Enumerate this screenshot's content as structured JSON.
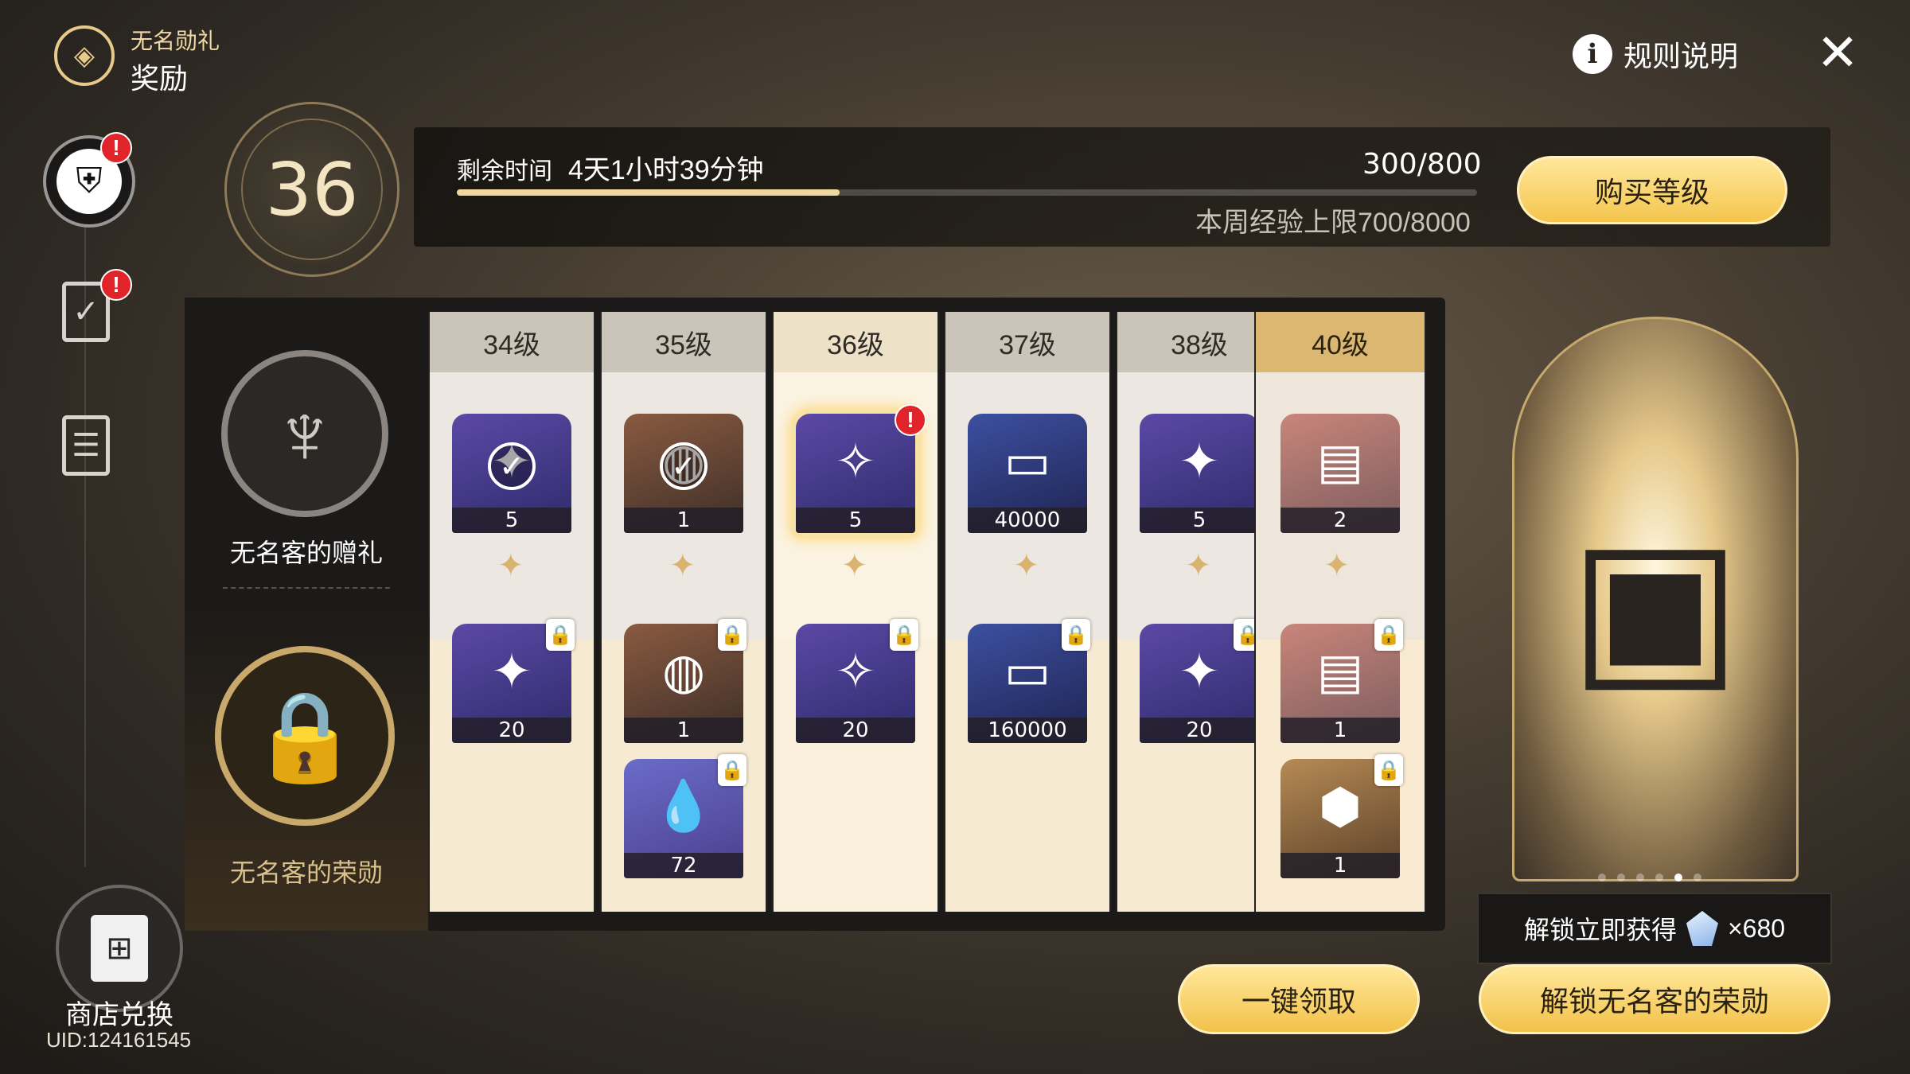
{
  "header": {
    "subtitle": "无名勋礼",
    "title": "奖励",
    "rules_label": "规则说明",
    "rules_icon": "info-icon",
    "close_icon": "close-icon"
  },
  "nav": {
    "badge": "!",
    "shop_label": "商店兑换",
    "uid": "UID:124161545"
  },
  "level": {
    "current": "36",
    "time_label": "剩余时间",
    "time_value": "4天1小时39分钟",
    "xp": "300/800",
    "progress": 0.375,
    "weekly": "本周经验上限700/8000",
    "buy_label": "购买等级"
  },
  "tiers": {
    "free_label": "无名客的赠礼",
    "paid_label": "无名客的荣勋"
  },
  "columns": [
    {
      "level": "34级",
      "free": [
        {
          "icon": "star-rail-pass-icon",
          "count": "5",
          "claimed": true,
          "color": "purple"
        }
      ],
      "paid": [
        {
          "icon": "star-rail-pass-icon",
          "count": "20",
          "color": "purple"
        }
      ]
    },
    {
      "level": "35级",
      "free": [
        {
          "icon": "orb-relic-icon",
          "count": "1",
          "claimed": true,
          "color": "brown"
        }
      ],
      "paid": [
        {
          "icon": "orb-relic-icon",
          "count": "1",
          "color": "brown"
        },
        {
          "icon": "tear-vial-icon",
          "count": "72",
          "color": "lilac"
        }
      ]
    },
    {
      "level": "36级",
      "free": [
        {
          "icon": "film-reel-icon",
          "count": "5",
          "alert": true,
          "color": "purple"
        }
      ],
      "paid": [
        {
          "icon": "film-reel-icon",
          "count": "20",
          "color": "purple"
        }
      ]
    },
    {
      "level": "37级",
      "free": [
        {
          "icon": "credit-card-icon",
          "count": "40000",
          "color": "navy"
        }
      ],
      "paid": [
        {
          "icon": "credit-card-icon",
          "count": "160000",
          "color": "navy"
        }
      ]
    },
    {
      "level": "38级",
      "free": [
        {
          "icon": "star-rail-pass-icon",
          "count": "5",
          "color": "purple"
        }
      ],
      "paid": [
        {
          "icon": "star-rail-pass-icon",
          "count": "20",
          "color": "purple"
        }
      ]
    },
    {
      "level": "40级",
      "free": [
        {
          "icon": "ticket-icon",
          "count": "2",
          "color": "rose"
        }
      ],
      "paid": [
        {
          "icon": "ticket-icon",
          "count": "1",
          "color": "rose"
        },
        {
          "icon": "golden-cube-icon",
          "count": "1",
          "color": "gold"
        }
      ]
    }
  ],
  "preview": {
    "icon": "treasure-chest-icon",
    "page": 5,
    "pages": 6
  },
  "footer": {
    "claim_label": "一键领取",
    "unlock_info": "解锁立即获得",
    "unlock_qty": "×680",
    "unlock_label": "解锁无名客的荣勋"
  }
}
